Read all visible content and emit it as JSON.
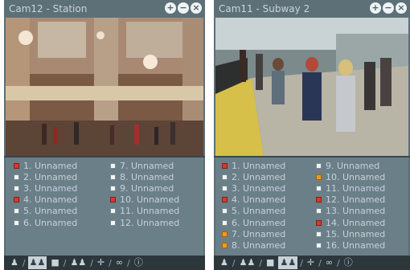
{
  "panels": [
    {
      "title": "Cam12 - Station",
      "sensors": [
        {
          "label": "1. Unnamed",
          "state": "red"
        },
        {
          "label": "2. Unnamed",
          "state": "white"
        },
        {
          "label": "3. Unnamed",
          "state": "white"
        },
        {
          "label": "4. Unnamed",
          "state": "red"
        },
        {
          "label": "5. Unnamed",
          "state": "white"
        },
        {
          "label": "6. Unnamed",
          "state": "white"
        },
        {
          "label": "7. Unnamed",
          "state": "white"
        },
        {
          "label": "8. Unnamed",
          "state": "white"
        },
        {
          "label": "9. Unnamed",
          "state": "white"
        },
        {
          "label": "10. Unnamed",
          "state": "red"
        },
        {
          "label": "11. Unnamed",
          "state": "white"
        },
        {
          "label": "12. Unnamed",
          "state": "white"
        }
      ]
    },
    {
      "title": "Cam11 - Subway 2",
      "sensors": [
        {
          "label": "1. Unnamed",
          "state": "red"
        },
        {
          "label": "2. Unnamed",
          "state": "white"
        },
        {
          "label": "3. Unnamed",
          "state": "white"
        },
        {
          "label": "4. Unnamed",
          "state": "red"
        },
        {
          "label": "5. Unnamed",
          "state": "white"
        },
        {
          "label": "6. Unnamed",
          "state": "white"
        },
        {
          "label": "7. Unnamed",
          "state": "orange"
        },
        {
          "label": "8. Unnamed",
          "state": "orange"
        },
        {
          "label": "9. Unnamed",
          "state": "white"
        },
        {
          "label": "10. Unnamed",
          "state": "orange"
        },
        {
          "label": "11. Unnamed",
          "state": "white"
        },
        {
          "label": "12. Unnamed",
          "state": "red"
        },
        {
          "label": "13. Unnamed",
          "state": "white"
        },
        {
          "label": "14. Unnamed",
          "state": "red"
        },
        {
          "label": "15. Unnamed",
          "state": "white"
        },
        {
          "label": "16. Unnamed",
          "state": "white"
        }
      ]
    }
  ],
  "window_buttons": {
    "add": "+",
    "minimize": "−",
    "close": "×"
  },
  "tab_icons": [
    "person-icon",
    "group-icon",
    "screen-icon",
    "group-icon",
    "move-icon",
    "link-icon",
    "info-icon"
  ],
  "colors": {
    "panel": "#5d6f77",
    "red": "#d53a2a",
    "orange": "#f29a1e",
    "white": "#f2f4f5"
  }
}
